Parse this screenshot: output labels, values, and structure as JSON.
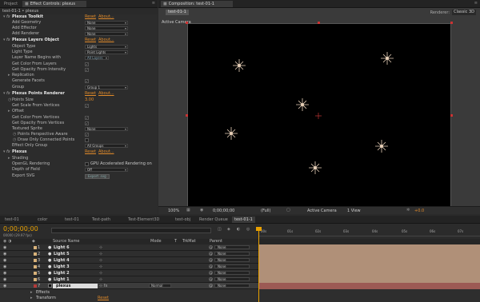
{
  "tabs_left": {
    "project": "Project",
    "effect_controls": "Effect Controls: plexus"
  },
  "tabs_right": {
    "composition": "Composition: test-01-1"
  },
  "breadcrumb": "test-01-1 • plexus",
  "comp_chip": "test-01-1",
  "renderer": {
    "label": "Renderer:",
    "value": "Classic 3D"
  },
  "viewer_label": "Active Camera",
  "panel": {
    "toolkit": {
      "fx": "fx",
      "title": "Plexus Toolkit",
      "reset": "Reset",
      "about": "About...",
      "rows": [
        {
          "label": "Add Geometry",
          "value": "None"
        },
        {
          "label": "Add Effector",
          "value": "None"
        },
        {
          "label": "Add Renderer",
          "value": "None"
        }
      ]
    },
    "layers": {
      "fx": "fx",
      "title": "Plexus Layers Object",
      "reset": "Reset",
      "about": "About...",
      "object_type": {
        "label": "Object Type",
        "value": "Lights"
      },
      "light_type": {
        "label": "Light Type",
        "value": "Point Lights"
      },
      "layer_name": {
        "label": "Layer Name Begins with",
        "value": "All Layers"
      },
      "get_color": {
        "label": "Get Color From Layers",
        "checked": "✓"
      },
      "get_opacity": {
        "label": "Get Opacity From Intensity",
        "checked": "✓"
      },
      "replication": {
        "label": "Replication"
      },
      "gen_facets": {
        "label": "Generate Facets",
        "checked": "✓"
      },
      "group": {
        "label": "Group",
        "value": "Group 1"
      }
    },
    "points": {
      "fx": "fx",
      "title": "Plexus Points Renderer",
      "reset": "Reset",
      "about": "About...",
      "points_size": {
        "label": "Points Size",
        "value": "3.00"
      },
      "scale_vertices": {
        "label": "Get Scale From Vertices",
        "checked": "✓"
      },
      "offset": {
        "label": "Offset"
      },
      "get_color_v": {
        "label": "Get Color From Vertices",
        "checked": "✓"
      },
      "get_opacity_v": {
        "label": "Get Opacity From Vertices",
        "checked": "✓"
      },
      "textured": {
        "label": "Textured Sprite",
        "value": "None"
      },
      "perspective": {
        "label": "Points Perspective Aware",
        "checked": "✓"
      },
      "draw_conn": {
        "label": "Draw Only Connected Points",
        "checked": ""
      },
      "effect_group": {
        "label": "Effect Only Group",
        "value": "All Groups"
      }
    },
    "plexus": {
      "fx": "fx",
      "title": "Plexus",
      "reset": "Reset",
      "about": "About...",
      "shading": {
        "label": "Shading"
      },
      "opengl": {
        "label": "OpenGL Rendering",
        "text": "GPU Accelerated Rendering on"
      },
      "dof": {
        "label": "Depth of Field",
        "value": "Off"
      },
      "export": {
        "label": "Export SVG",
        "button": "Export .svg"
      }
    }
  },
  "viewer_bar": {
    "zoom": "100%",
    "timecode": "0;00;00;00",
    "quality": "(Full)",
    "camera": "Active Camera",
    "views": "1 View",
    "exposure": "+0.0"
  },
  "timeline_tabs": [
    "test-01",
    "color",
    "test-01",
    "Test-path",
    "Test-Element3D",
    "test-obj",
    "Render Queue",
    "test-01-1"
  ],
  "timeline_tab_active": 7,
  "timecode": "0;00;00;00",
  "fps": "00000 (29.97 fps)",
  "ruler": [
    "00s",
    "01s",
    "02s",
    "03s",
    "04s",
    "05s",
    "06s",
    "07s"
  ],
  "headers": {
    "source": "Source Name",
    "mode": "Mode",
    "t": "T",
    "trkmat": "TrkMat",
    "parent": "Parent"
  },
  "layers": [
    {
      "num": "1",
      "name": "Light 6",
      "parent": "None",
      "color": "#d8b27a"
    },
    {
      "num": "2",
      "name": "Light 5",
      "parent": "None",
      "color": "#d8b27a"
    },
    {
      "num": "3",
      "name": "Light 4",
      "parent": "None",
      "color": "#d8b27a"
    },
    {
      "num": "4",
      "name": "Light 3",
      "parent": "None",
      "color": "#d8b27a"
    },
    {
      "num": "5",
      "name": "Light 2",
      "parent": "None",
      "color": "#d8b27a"
    },
    {
      "num": "6",
      "name": "Light 1",
      "parent": "None",
      "color": "#d8b27a"
    },
    {
      "num": "7",
      "name": "plexus",
      "parent": "None",
      "mode": "Normal",
      "color": "#b33a3a"
    }
  ],
  "sub": {
    "effects": "Effects",
    "transform": "Transform",
    "reset": "Reset"
  },
  "colors": {
    "accent": "#e08a2a",
    "playhead": "#e8a000",
    "layer_bar": "#b09078",
    "plexus_bar": "#9c5a54",
    "comp_bg": "#000000"
  }
}
